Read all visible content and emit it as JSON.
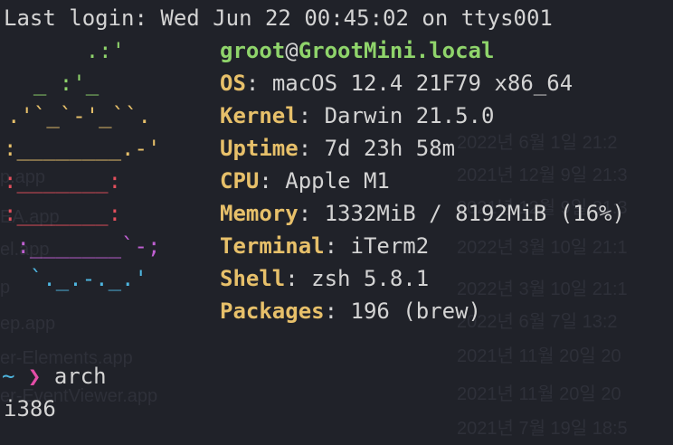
{
  "header": {
    "last_login": "Last login: Wed Jun 22 00:45:02 on ttys001"
  },
  "logo": {
    "colors": [
      "#8fd46b",
      "#8fd46b",
      "#8fd46b",
      "#e7c06a",
      "#e27d4c",
      "#e24f5c",
      "#e24f5c",
      "#c060d2",
      "#4eb6e0"
    ],
    "lines": [
      "      .:'",
      "  _ :'_",
      ".'`_`-'_``.",
      ":________.-'",
      ":_______:",
      ":_______:",
      " :_______`-;",
      "  `._.-._.'"
    ]
  },
  "info": {
    "user": "groot",
    "at": "@",
    "host": "GrootMini.local",
    "rows": [
      {
        "label": "OS",
        "value": "macOS 12.4 21F79 x86_64"
      },
      {
        "label": "Kernel",
        "value": "Darwin 21.5.0"
      },
      {
        "label": "Uptime",
        "value": "7d 23h 58m"
      },
      {
        "label": "CPU",
        "value": "Apple M1"
      },
      {
        "label": "Memory",
        "value": "1332MiB / 8192MiB (16%)"
      },
      {
        "label": "Terminal",
        "value": "iTerm2"
      },
      {
        "label": "Shell",
        "value": "zsh 5.8.1"
      },
      {
        "label": "Packages",
        "value": "196 (brew)"
      }
    ]
  },
  "prompt": {
    "tilde": "~",
    "arrow": "❯",
    "command": "arch",
    "output": "i386"
  },
  "background": {
    "left": [
      "p.app",
      "EA.app",
      "el.app",
      "p",
      "ep.app",
      "er-Elements.app",
      "er-EventViewer.app"
    ],
    "right": [
      "2022년 6월 1일 21:2",
      "2021년 12월 9일 21:3",
      "2021년 12월 9일 21:3",
      "2022년 3월 10일 21:1",
      "2022년 3월 10일 21:1",
      "2022년 6월 7일 13:2",
      "2021년 11월 20일 20",
      "2021년 11월 20일 20",
      "2021년 7월 19일 18:5"
    ]
  }
}
